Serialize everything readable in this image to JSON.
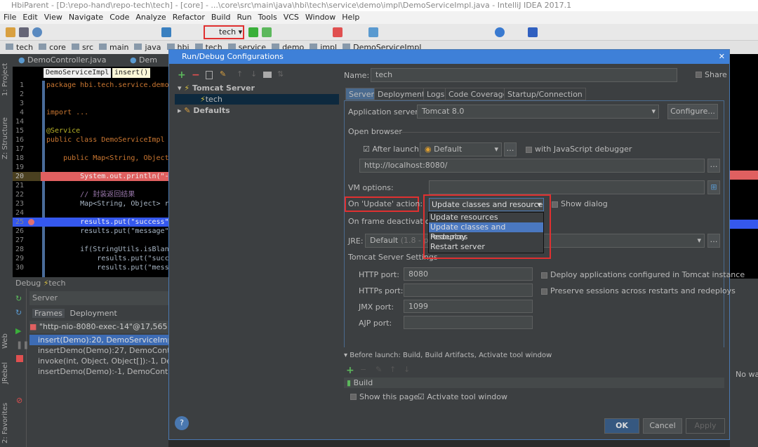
{
  "window": {
    "title": "HbiParent - [D:\\repo-hand\\repo-tech\\tech] - [core] - ...\\core\\src\\main\\java\\hbi\\tech\\service\\demo\\impl\\DemoServiceImpl.java - IntelliJ IDEA 2017.1"
  },
  "menu": [
    "File",
    "Edit",
    "View",
    "Navigate",
    "Code",
    "Analyze",
    "Refactor",
    "Build",
    "Run",
    "Tools",
    "VCS",
    "Window",
    "Help"
  ],
  "toolbar": {
    "run_config": "tech",
    "accent_highlight": "#e03030"
  },
  "breadcrumbs": [
    "tech",
    "core",
    "src",
    "main",
    "java",
    "hbi",
    "tech",
    "service",
    "demo",
    "impl",
    "DemoServiceImpl"
  ],
  "editor": {
    "tabs": [
      "DemoController.java",
      "Dem"
    ],
    "crumb_class": "DemoServiceImpl",
    "crumb_method": "insert()",
    "lines": [
      {
        "n": "1",
        "code": "package hbi.tech.service.demo."
      },
      {
        "n": "2",
        "code": ""
      },
      {
        "n": "3",
        "code": ""
      },
      {
        "n": "4",
        "code": "import ..."
      },
      {
        "n": "14",
        "code": ""
      },
      {
        "n": "15",
        "code": "@Service"
      },
      {
        "n": "16",
        "code": "public class DemoServiceImpl e"
      },
      {
        "n": "17",
        "code": ""
      },
      {
        "n": "18",
        "code": "    public Map<String, Object>"
      },
      {
        "n": "19",
        "code": ""
      },
      {
        "n": "20",
        "code": "        System.out.println(\"--"
      },
      {
        "n": "21",
        "code": ""
      },
      {
        "n": "22",
        "code": "        // 封装返回结果"
      },
      {
        "n": "23",
        "code": "        Map<String, Object> re"
      },
      {
        "n": "24",
        "code": ""
      },
      {
        "n": "25",
        "code": "        results.put(\"success\""
      },
      {
        "n": "26",
        "code": "        results.put(\"message\""
      },
      {
        "n": "27",
        "code": ""
      },
      {
        "n": "28",
        "code": "        if(StringUtils.isBlank"
      },
      {
        "n": "29",
        "code": "            results.put(\"succe"
      },
      {
        "n": "30",
        "code": "            results.put(\"messa"
      }
    ]
  },
  "side_tools": [
    "1: Project",
    "Z: Structure",
    "Web",
    "JRebel",
    "2: Favorites"
  ],
  "debug": {
    "title": "Debug",
    "config": "tech",
    "server_tab": "Server",
    "frames_tab": "Frames",
    "deployment_tab": "Deployment",
    "thread": "\"http-nio-8080-exec-14\"@17,565 in g",
    "frames": [
      "insert(Demo):20, DemoServiceImpl (hbi",
      "insertDemo(Demo):27, DemoController",
      "invoke(int, Object, Object[]):-1, DemoCo",
      "insertDemo(Demo):-1, DemoController"
    ]
  },
  "right_pane": {
    "no_watches": "No wa"
  },
  "dialog": {
    "title": "Run/Debug Configurations",
    "tree": {
      "tomcat": "Tomcat Server",
      "tech": "tech",
      "defaults": "Defaults"
    },
    "name_label": "Name:",
    "name_value": "tech",
    "share_label": "Share",
    "tabs": [
      "Server",
      "Deployment",
      "Logs",
      "Code Coverage",
      "Startup/Connection"
    ],
    "app_server_label": "Application server:",
    "app_server_value": "Tomcat 8.0",
    "configure_btn": "Configure...",
    "open_browser": "Open browser",
    "after_launch": "After launch",
    "browser": "Default",
    "js_debugger": "with JavaScript debugger",
    "url": "http://localhost:8080/",
    "vm_label": "VM options:",
    "vm_value": "",
    "update_label": "On 'Update' action:",
    "update_value": "Update classes and resources",
    "show_dialog": "Show dialog",
    "update_options": [
      "Update resources",
      "Update classes and resources",
      "Redeploy",
      "Restart server"
    ],
    "frame_label": "On frame deactivation:",
    "jre_label": "JRE:",
    "jre_value": "Default",
    "jre_hint": "(1.8 - proj",
    "tomcat_settings": "Tomcat Server Settings",
    "http_label": "HTTP port:",
    "http_value": "8080",
    "https_label": "HTTPs port:",
    "https_value": "",
    "jmx_label": "JMX port:",
    "jmx_value": "1099",
    "ajp_label": "AJP port:",
    "ajp_value": "",
    "deploy_apps": "Deploy applications configured in Tomcat instance",
    "preserve": "Preserve sessions across restarts and redeploys",
    "before_launch": "Before launch: Build, Build Artifacts, Activate tool window",
    "build_item": "Build",
    "show_page": "Show this page",
    "activate_tool": "Activate tool window",
    "ok": "OK",
    "cancel": "Cancel",
    "apply": "Apply",
    "help": "?"
  }
}
